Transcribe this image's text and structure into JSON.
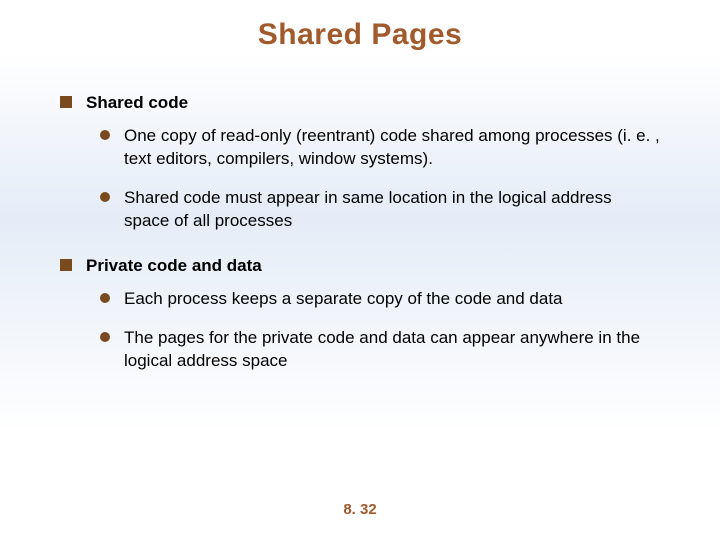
{
  "title": "Shared Pages",
  "sections": [
    {
      "heading": "Shared code",
      "items": [
        "One copy of read-only (reentrant) code shared among processes (i. e. , text editors, compilers, window systems).",
        "Shared code must appear in same location in the logical address space of all processes"
      ]
    },
    {
      "heading": "Private code and data",
      "items": [
        "Each process keeps a separate copy of the code and data",
        "The pages for the private code and data can appear anywhere in the logical address space"
      ]
    }
  ],
  "footer": "8. 32"
}
